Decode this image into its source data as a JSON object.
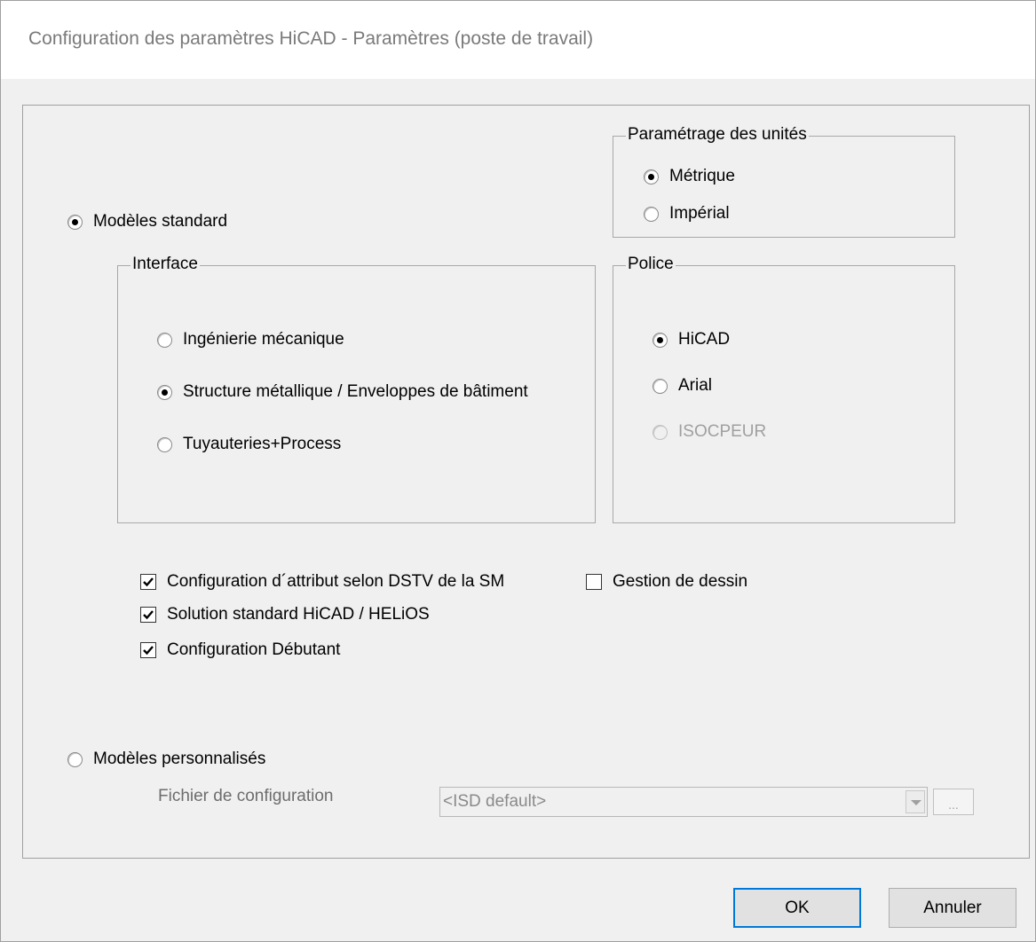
{
  "window": {
    "title": "Configuration des paramètres HiCAD - Paramètres (poste de travail)"
  },
  "units_group": {
    "label": "Paramétrage des unités",
    "options": [
      {
        "label": "Métrique",
        "checked": true
      },
      {
        "label": "Impérial",
        "checked": false
      }
    ]
  },
  "standard_models": {
    "label": "Modèles standard",
    "checked": true
  },
  "interface_group": {
    "label": "Interface",
    "options": [
      {
        "label": "Ingénierie mécanique",
        "checked": false
      },
      {
        "label": "Structure métallique / Enveloppes de bâtiment",
        "checked": true
      },
      {
        "label": "Tuyauteries+Process",
        "checked": false
      }
    ]
  },
  "font_group": {
    "label": "Police",
    "options": [
      {
        "label": "HiCAD",
        "checked": true,
        "enabled": true
      },
      {
        "label": "Arial",
        "checked": false,
        "enabled": true
      },
      {
        "label": "ISOCPEUR",
        "checked": false,
        "enabled": false
      }
    ]
  },
  "checkboxes": [
    {
      "label": "Configuration d´attribut selon DSTV de la SM",
      "checked": true
    },
    {
      "label": "Solution standard HiCAD / HELiOS",
      "checked": true
    },
    {
      "label": "Configuration Débutant",
      "checked": true
    },
    {
      "label": "Gestion de dessin",
      "checked": false
    }
  ],
  "custom_models": {
    "label": "Modèles personnalisés",
    "checked": false
  },
  "config_file": {
    "label": "Fichier de configuration",
    "value": "<ISD default>",
    "browse_label": "..."
  },
  "buttons": {
    "ok": "OK",
    "cancel": "Annuler"
  }
}
